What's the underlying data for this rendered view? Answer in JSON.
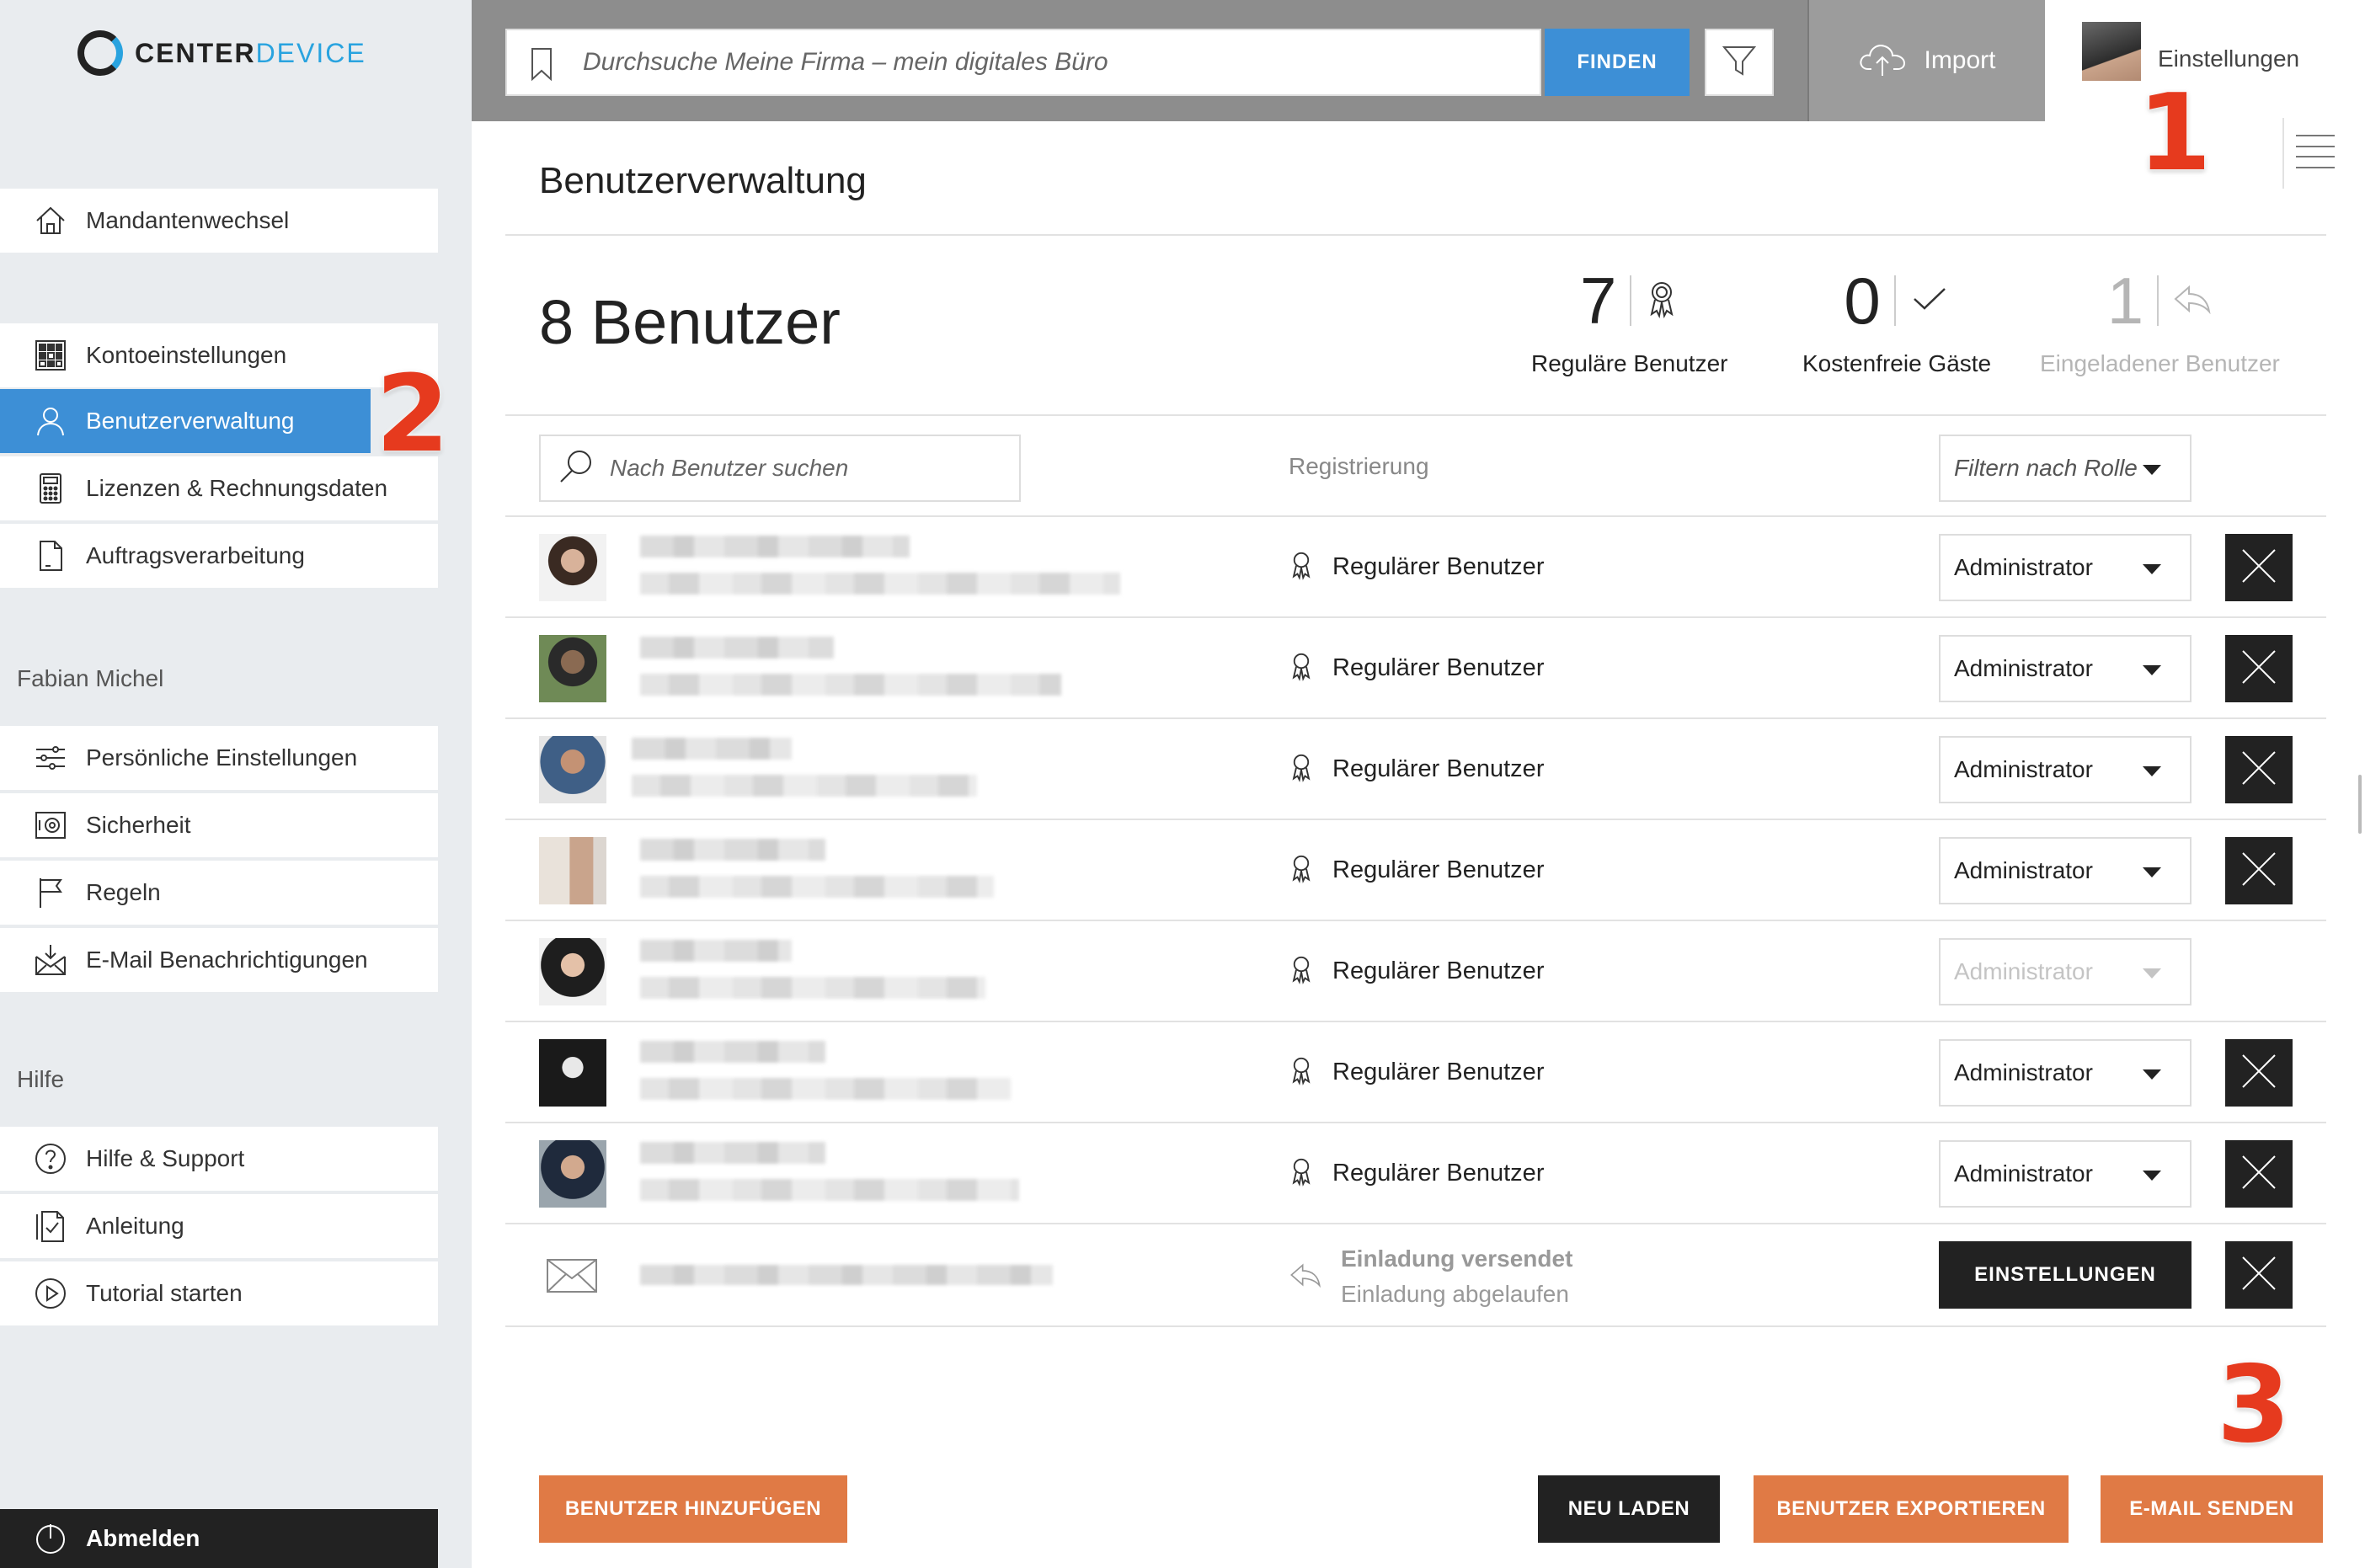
{
  "brand": {
    "name_part1": "CENTER",
    "name_part2": "DEVICE",
    "accent": "#29a3df"
  },
  "topbar": {
    "search_placeholder": "Durchsuche Meine Firma – mein digitales Büro",
    "find_label": "FINDEN",
    "import_label": "Import",
    "settings_label": "Einstellungen"
  },
  "sidebar": {
    "tenant_switch": "Mandantenwechsel",
    "account_items": [
      {
        "label": "Kontoeinstellungen",
        "icon": "grid-icon"
      },
      {
        "label": "Benutzerverwaltung",
        "icon": "user-icon",
        "active": true
      },
      {
        "label": "Lizenzen & Rechnungsdaten",
        "icon": "calculator-icon"
      },
      {
        "label": "Auftragsverarbeitung",
        "icon": "document-icon"
      }
    ],
    "user_section_label": "Fabian Michel",
    "user_items": [
      {
        "label": "Persönliche Einstellungen",
        "icon": "sliders-icon"
      },
      {
        "label": "Sicherheit",
        "icon": "safe-icon"
      },
      {
        "label": "Regeln",
        "icon": "flag-icon"
      },
      {
        "label": "E-Mail Benachrichtigungen",
        "icon": "mail-download-icon"
      }
    ],
    "help_section_label": "Hilfe",
    "help_items": [
      {
        "label": "Hilfe & Support",
        "icon": "question-icon"
      },
      {
        "label": "Anleitung",
        "icon": "checklist-icon"
      },
      {
        "label": "Tutorial starten",
        "icon": "play-icon"
      }
    ],
    "logout_label": "Abmelden"
  },
  "annotations": {
    "one": "1",
    "two": "2",
    "three": "3",
    "color": "#e63a1e"
  },
  "main": {
    "title": "Benutzerverwaltung",
    "user_count": "8 Benutzer",
    "stats": [
      {
        "value": "7",
        "label": "Reguläre Benutzer",
        "icon": "ribbon-icon"
      },
      {
        "value": "0",
        "label": "Kostenfreie Gäste",
        "icon": "check-icon"
      },
      {
        "value": "1",
        "label": "Eingeladener Benutzer",
        "icon": "reply-icon"
      }
    ],
    "user_search_placeholder": "Nach Benutzer suchen",
    "registration_header": "Registrierung",
    "role_filter_label": "Filtern nach Rolle",
    "rows": [
      {
        "registration": "Regulärer Benutzer",
        "role": "Administrator",
        "deletable": true
      },
      {
        "registration": "Regulärer Benutzer",
        "role": "Administrator",
        "deletable": true
      },
      {
        "registration": "Regulärer Benutzer",
        "role": "Administrator",
        "deletable": true
      },
      {
        "registration": "Regulärer Benutzer",
        "role": "Administrator",
        "deletable": true
      },
      {
        "registration": "Regulärer Benutzer",
        "role": "Administrator",
        "deletable": false
      },
      {
        "registration": "Regulärer Benutzer",
        "role": "Administrator",
        "deletable": true
      },
      {
        "registration": "Regulärer Benutzer",
        "role": "Administrator",
        "deletable": true
      }
    ],
    "invite_row": {
      "status_line1": "Einladung versendet",
      "status_line2": "Einladung abgelaufen",
      "settings_button": "EINSTELLUNGEN"
    },
    "buttons": {
      "add_user": "BENUTZER HINZUFÜGEN",
      "reload": "NEU LADEN",
      "export": "BENUTZER EXPORTIEREN",
      "send_email": "E-MAIL SENDEN"
    },
    "colors": {
      "primary": "#3d8fd6",
      "orange": "#e07a45",
      "dark": "#222222"
    }
  }
}
